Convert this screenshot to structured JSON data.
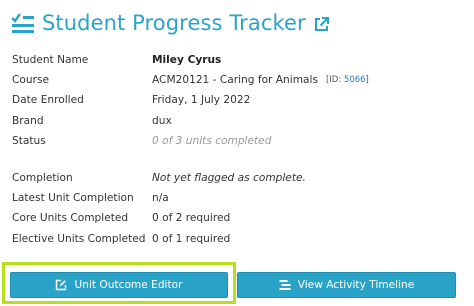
{
  "header": {
    "title": "Student Progress Tracker",
    "icon": "checklist-icon",
    "external_icon": "external-link-icon",
    "accent": "#2aa3c9"
  },
  "info_rows": {
    "student_name": {
      "label": "Student Name",
      "value": "Miley Cyrus"
    },
    "course": {
      "label": "Course",
      "value": "ACM20121 - Caring for Animals",
      "id_prefix": "[ID:",
      "id_value": "5066",
      "id_suffix": "]"
    },
    "date_enrolled": {
      "label": "Date Enrolled",
      "value": "Friday, 1 July 2022"
    },
    "brand": {
      "label": "Brand",
      "value": "dux"
    },
    "status": {
      "label": "Status",
      "value": "0 of 3 units completed"
    },
    "completion": {
      "label": "Completion",
      "value": "Not yet flagged as complete."
    },
    "latest_unit": {
      "label": "Latest Unit Completion",
      "value": "n/a"
    },
    "core_units": {
      "label": "Core Units Completed",
      "value": "0 of 2 required"
    },
    "elective_units": {
      "label": "Elective Units Completed",
      "value": "0 of 1 required"
    }
  },
  "buttons": {
    "unit_outcome_editor": {
      "label": "Unit Outcome Editor",
      "icon": "edit-icon"
    },
    "view_activity_timeline": {
      "label": "View Activity Timeline",
      "icon": "timeline-icon"
    },
    "highlight_color": "#b6e01e"
  }
}
